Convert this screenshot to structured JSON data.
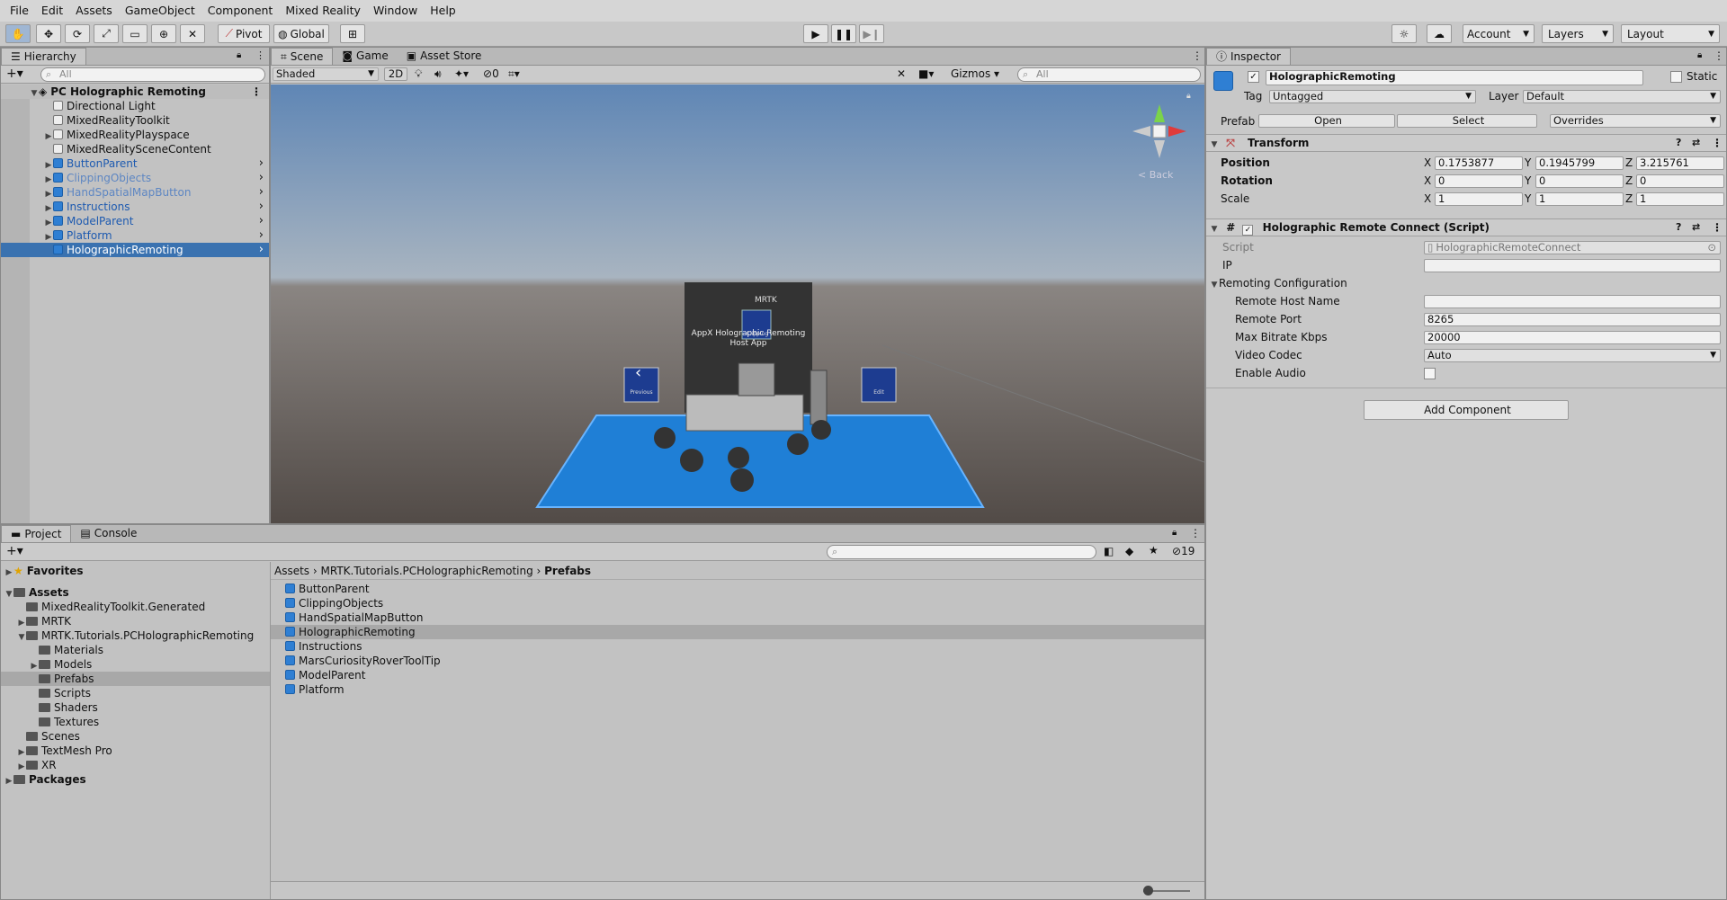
{
  "menu": [
    "File",
    "Edit",
    "Assets",
    "GameObject",
    "Component",
    "Mixed Reality",
    "Window",
    "Help"
  ],
  "toolbar": {
    "pivot": "Pivot",
    "global": "Global",
    "account": "Account",
    "layers": "Layers",
    "layout": "Layout"
  },
  "hierarchy": {
    "tab": "Hierarchy",
    "search_placeholder": "All",
    "scene": "PC Holographic Remoting",
    "items": [
      {
        "label": "Directional Light",
        "style": "plain",
        "expand": false
      },
      {
        "label": "MixedRealityToolkit",
        "style": "plain",
        "expand": false
      },
      {
        "label": "MixedRealityPlayspace",
        "style": "plain",
        "expand": true
      },
      {
        "label": "MixedRealitySceneContent",
        "style": "plain",
        "expand": false
      },
      {
        "label": "ButtonParent",
        "style": "prefab",
        "expand": true
      },
      {
        "label": "ClippingObjects",
        "style": "prefab-light",
        "expand": true
      },
      {
        "label": "HandSpatialMapButton",
        "style": "prefab-light",
        "expand": true
      },
      {
        "label": "Instructions",
        "style": "prefab",
        "expand": true
      },
      {
        "label": "ModelParent",
        "style": "prefab",
        "expand": true
      },
      {
        "label": "Platform",
        "style": "prefab",
        "expand": true
      },
      {
        "label": "HolographicRemoting",
        "style": "selected",
        "expand": false
      }
    ]
  },
  "scene": {
    "tabs": [
      "Scene",
      "Game",
      "Asset Store"
    ],
    "shading": "Shaded",
    "mode2d": "2D",
    "hidden_count": "0",
    "gizmos": "Gizmos",
    "search_placeholder": "All",
    "back": "< Back",
    "panel_title": "AppX Holographic Remoting Host App",
    "panel_brand": "MRTK",
    "btn_left_label": "Previous",
    "btn_mid_label": "Clipping",
    "btn_right_label": "Edit"
  },
  "project": {
    "tabs": [
      "Project",
      "Console"
    ],
    "hidden_count": "19",
    "breadcrumb": [
      "Assets",
      "MRTK.Tutorials.PCHolographicRemoting",
      "Prefabs"
    ],
    "tree": [
      {
        "label": "Favorites",
        "indent": 0,
        "bold": true,
        "expand": "right",
        "icon": "star"
      },
      {
        "label": "Assets",
        "indent": 0,
        "bold": true,
        "expand": "down",
        "icon": "folder"
      },
      {
        "label": "MixedRealityToolkit.Generated",
        "indent": 1,
        "expand": "none",
        "icon": "folder"
      },
      {
        "label": "MRTK",
        "indent": 1,
        "expand": "right",
        "icon": "folder"
      },
      {
        "label": "MRTK.Tutorials.PCHolographicRemoting",
        "indent": 1,
        "expand": "down",
        "icon": "folder"
      },
      {
        "label": "Materials",
        "indent": 2,
        "expand": "none",
        "icon": "folder"
      },
      {
        "label": "Models",
        "indent": 2,
        "expand": "right",
        "icon": "folder"
      },
      {
        "label": "Prefabs",
        "indent": 2,
        "expand": "none",
        "icon": "folder",
        "selected": true
      },
      {
        "label": "Scripts",
        "indent": 2,
        "expand": "none",
        "icon": "folder"
      },
      {
        "label": "Shaders",
        "indent": 2,
        "expand": "none",
        "icon": "folder"
      },
      {
        "label": "Textures",
        "indent": 2,
        "expand": "none",
        "icon": "folder"
      },
      {
        "label": "Scenes",
        "indent": 1,
        "expand": "none",
        "icon": "folder"
      },
      {
        "label": "TextMesh Pro",
        "indent": 1,
        "expand": "right",
        "icon": "folder"
      },
      {
        "label": "XR",
        "indent": 1,
        "expand": "right",
        "icon": "folder"
      },
      {
        "label": "Packages",
        "indent": 0,
        "bold": true,
        "expand": "right",
        "icon": "folder"
      }
    ],
    "files": [
      "ButtonParent",
      "ClippingObjects",
      "HandSpatialMapButton",
      "HolographicRemoting",
      "Instructions",
      "MarsCuriosityRoverToolTip",
      "ModelParent",
      "Platform"
    ],
    "selected_file": "HolographicRemoting",
    "zoom": 0.1
  },
  "inspector": {
    "tab": "Inspector",
    "object_name": "HolographicRemoting",
    "static": "Static",
    "tag_label": "Tag",
    "tag_value": "Untagged",
    "layer_label": "Layer",
    "layer_value": "Default",
    "prefab_label": "Prefab",
    "open": "Open",
    "select": "Select",
    "overrides": "Overrides",
    "transform": {
      "title": "Transform",
      "rows": [
        {
          "label": "Position",
          "x": "0.1753877",
          "y": "0.1945799",
          "z": "3.215761"
        },
        {
          "label": "Rotation",
          "x": "0",
          "y": "0",
          "z": "0"
        },
        {
          "label": "Scale",
          "x": "1",
          "y": "1",
          "z": "1"
        }
      ]
    },
    "script_component": {
      "title": "Holographic Remote Connect (Script)",
      "script_label": "Script",
      "script_value": "HolographicRemoteConnect",
      "ip_label": "IP",
      "ip_value": "",
      "config_label": "Remoting Configuration",
      "host_label": "Remote Host Name",
      "host_value": "",
      "port_label": "Remote Port",
      "port_value": "8265",
      "bitrate_label": "Max Bitrate Kbps",
      "bitrate_value": "20000",
      "codec_label": "Video Codec",
      "codec_value": "Auto",
      "audio_label": "Enable Audio"
    },
    "add_component": "Add Component"
  }
}
